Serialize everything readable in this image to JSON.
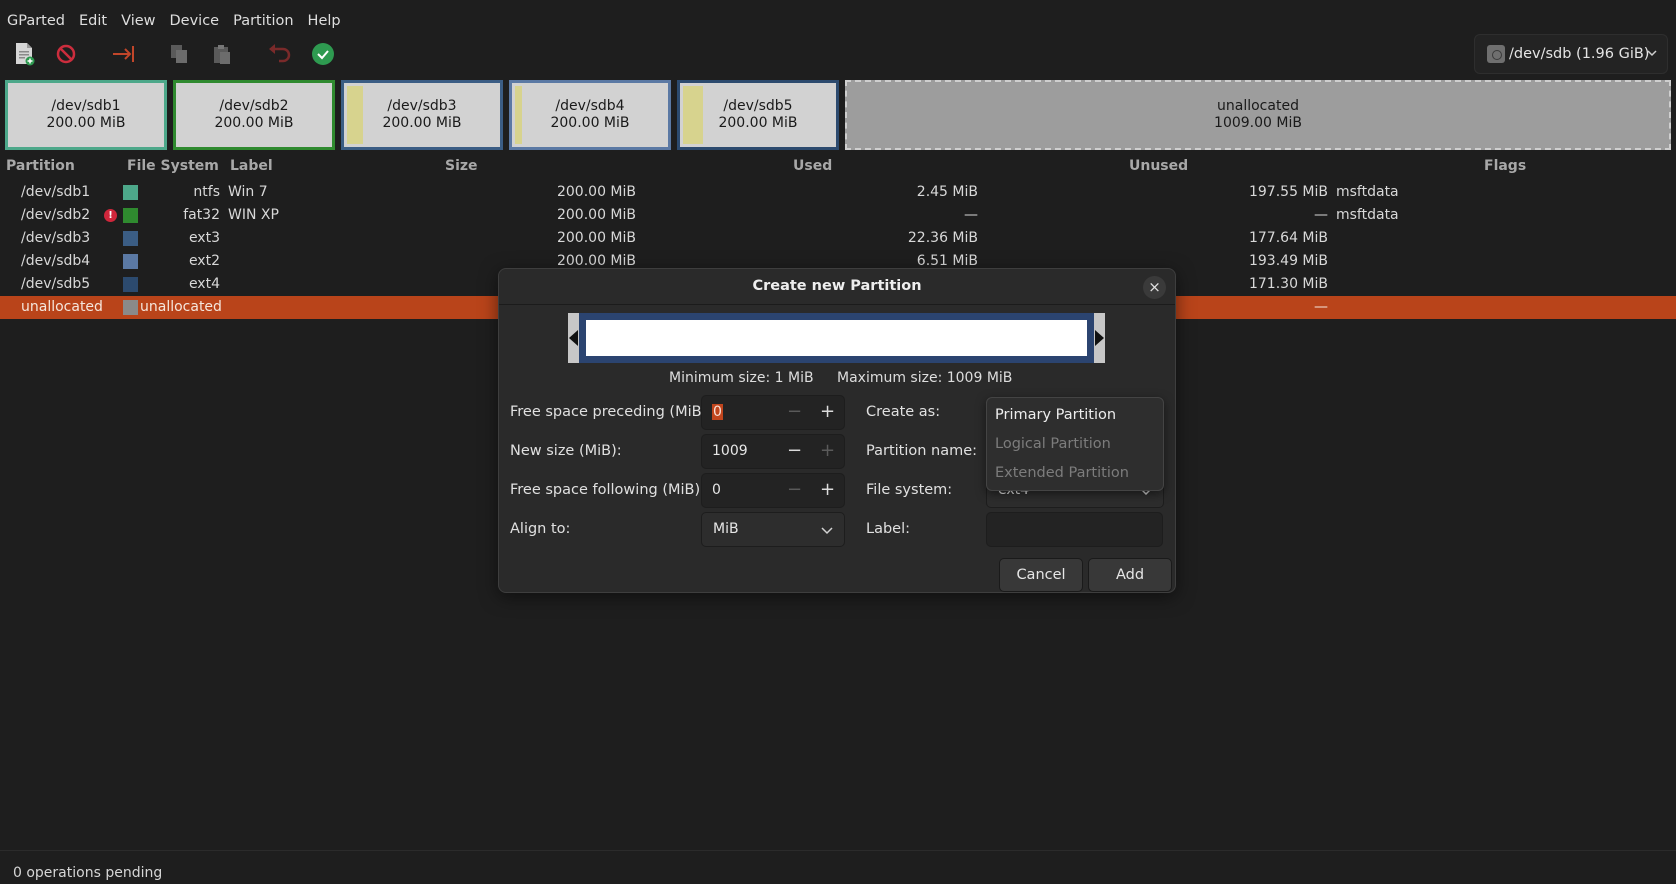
{
  "menu": [
    "GParted",
    "Edit",
    "View",
    "Device",
    "Partition",
    "Help"
  ],
  "device_selector": {
    "label": "/dev/sdb (1.96 GiB)"
  },
  "partition_map": [
    {
      "name": "/dev/sdb1",
      "size": "200.00 MiB",
      "color": "#4da88a"
    },
    {
      "name": "/dev/sdb2",
      "size": "200.00 MiB",
      "color": "#2f8a2f"
    },
    {
      "name": "/dev/sdb3",
      "size": "200.00 MiB",
      "color": "#3b5d84"
    },
    {
      "name": "/dev/sdb4",
      "size": "200.00 MiB",
      "color": "#5b79a4"
    },
    {
      "name": "/dev/sdb5",
      "size": "200.00 MiB",
      "color": "#2c4a6e"
    },
    {
      "name": "unallocated",
      "size": "1009.00 MiB",
      "color": "#a0a0a0"
    }
  ],
  "table": {
    "headers": {
      "partition": "Partition",
      "filesystem": "File System",
      "label": "Label",
      "size": "Size",
      "used": "Used",
      "unused": "Unused",
      "flags": "Flags"
    },
    "rows": [
      {
        "partition": "/dev/sdb1",
        "fs": "ntfs",
        "label": "Win 7",
        "size": "200.00 MiB",
        "used": "2.45 MiB",
        "unused": "197.55 MiB",
        "flags": "msftdata",
        "color": "#4da88a"
      },
      {
        "partition": "/dev/sdb2",
        "fs": "fat32",
        "label": "WIN XP",
        "size": "200.00 MiB",
        "used": "—",
        "unused": "—",
        "flags": "msftdata",
        "color": "#2f8a2f"
      },
      {
        "partition": "/dev/sdb3",
        "fs": "ext3",
        "label": "",
        "size": "200.00 MiB",
        "used": "22.36 MiB",
        "unused": "177.64 MiB",
        "flags": "",
        "color": "#3b5d84"
      },
      {
        "partition": "/dev/sdb4",
        "fs": "ext2",
        "label": "",
        "size": "200.00 MiB",
        "used": "6.51 MiB",
        "unused": "193.49 MiB",
        "flags": "",
        "color": "#5b79a4"
      },
      {
        "partition": "/dev/sdb5",
        "fs": "ext4",
        "label": "",
        "size": "",
        "used": "",
        "unused": "171.30 MiB",
        "flags": "",
        "color": "#2c4a6e"
      },
      {
        "partition": "unallocated",
        "fs": "unallocated",
        "label": "",
        "size": "",
        "used": "",
        "unused": "—",
        "flags": "",
        "color": "#8a8a8a"
      }
    ]
  },
  "status": {
    "text": "0 operations pending"
  },
  "dialog": {
    "title": "Create new Partition",
    "close_symbol": "×",
    "min_size": "Minimum size: 1 MiB",
    "max_size": "Maximum size: 1009 MiB",
    "fields": {
      "preceding": {
        "label": "Free space preceding (MiB):",
        "value": "0"
      },
      "new_size": {
        "label": "New size (MiB):",
        "value": "1009"
      },
      "following": {
        "label": "Free space following (MiB):",
        "value": "0"
      },
      "align": {
        "label": "Align to:",
        "value": "MiB"
      },
      "create_as": {
        "label": "Create as:"
      },
      "partition_name": {
        "label": "Partition name:"
      },
      "file_system": {
        "label": "File system:",
        "value": "ext4"
      },
      "label": {
        "label": "Label:",
        "value": ""
      }
    },
    "create_as_options": [
      "Primary Partition",
      "Logical Partition",
      "Extended Partition"
    ],
    "buttons": {
      "cancel": "Cancel",
      "add": "Add"
    },
    "spin": {
      "minus": "−",
      "plus": "+"
    }
  },
  "colors": {
    "selection": "#b9441a",
    "accent_ok": "#2e9a50",
    "danger": "#cc2d3d"
  }
}
